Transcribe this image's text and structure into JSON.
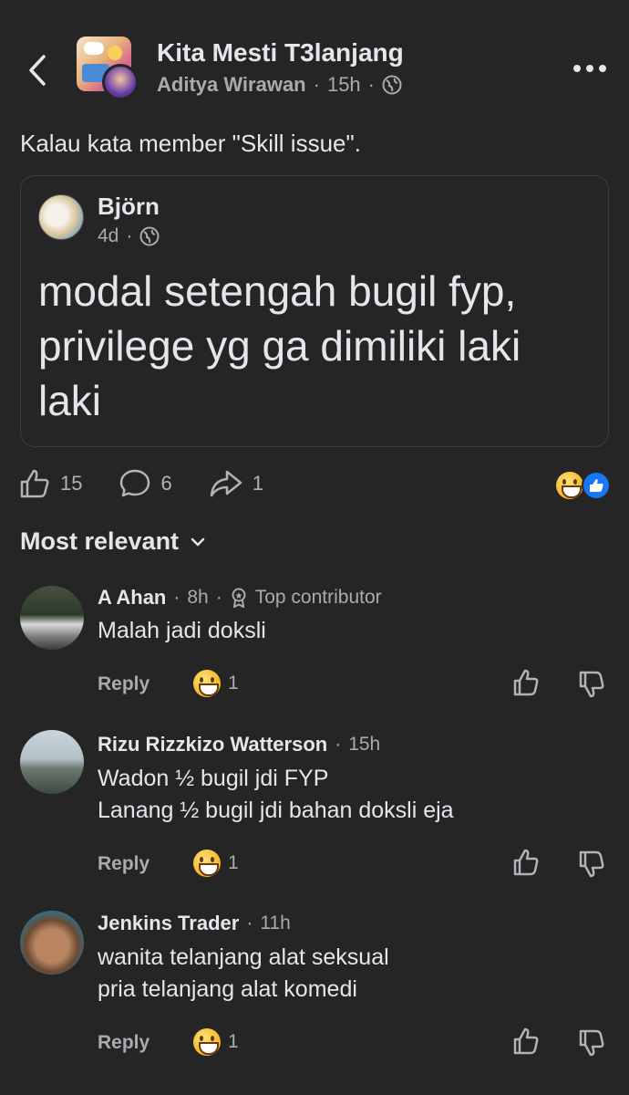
{
  "header": {
    "group_name": "Kita Mesti T3lanjang",
    "author": "Aditya Wirawan",
    "time": "15h",
    "sep": "·"
  },
  "post": {
    "caption": "Kalau kata member \"Skill issue\".",
    "shared": {
      "author": "Björn",
      "time": "4d",
      "sep": "·",
      "text": "modal setengah bugil fyp, privilege yg ga dimiliki laki laki"
    },
    "stats": {
      "likes": "15",
      "comments": "6",
      "shares": "1"
    }
  },
  "sort": {
    "label": "Most relevant"
  },
  "comments": [
    {
      "name": "A Ahan",
      "time": "8h",
      "badge": "Top contributor",
      "text": "Malah jadi doksli",
      "reply_label": "Reply",
      "reactions": "1"
    },
    {
      "name": "Rizu Rizzkizo Watterson",
      "time": "15h",
      "text_line1": "Wadon ½ bugil jdi FYP",
      "text_line2": "Lanang ½ bugil jdi bahan doksli eja",
      "reply_label": "Reply",
      "reactions": "1"
    },
    {
      "name": "Jenkins Trader",
      "time": "11h",
      "text_line1": "wanita telanjang alat seksual",
      "text_line2": "pria telanjang alat komedi",
      "reply_label": "Reply",
      "reactions": "1"
    }
  ],
  "icons": {
    "back": "chevron-left-icon",
    "more": "more-dots-icon",
    "globe": "globe-icon",
    "like": "thumbs-up-icon",
    "comment": "comment-bubble-icon",
    "share": "share-arrow-icon",
    "dislike": "thumbs-down-icon",
    "chevron": "chevron-down-icon"
  },
  "colors": {
    "background": "#252526",
    "text": "#e4e6eb",
    "muted": "#a8abaf",
    "like_blue": "#1877f2"
  }
}
